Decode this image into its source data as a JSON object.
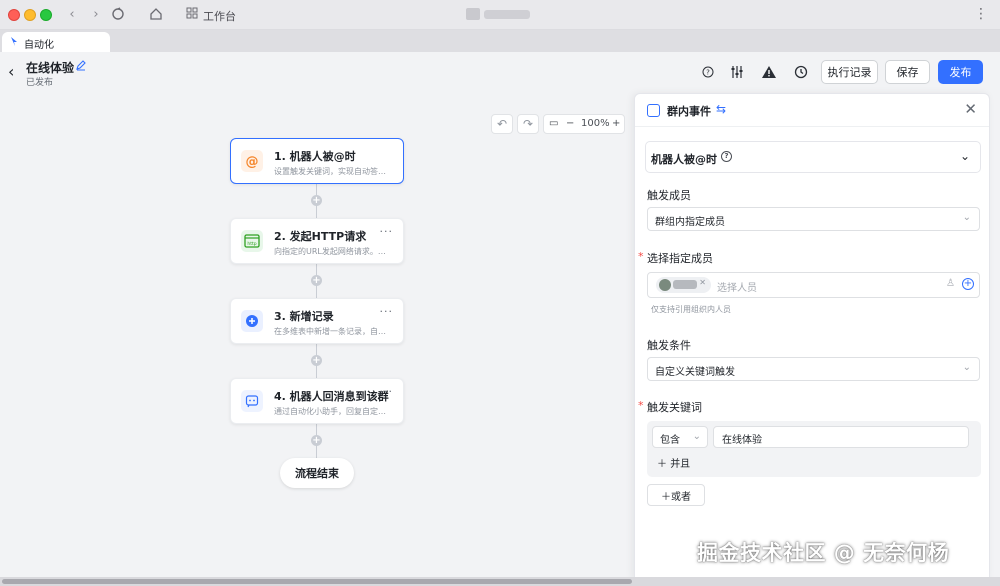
{
  "titlebar": {
    "workspace_label": "工作台"
  },
  "tab": {
    "label": "自动化"
  },
  "header": {
    "title": "在线体验",
    "status": "已发布",
    "buttons": {
      "run_history": "执行记录",
      "save": "保存",
      "publish": "发布"
    }
  },
  "toolbar": {
    "zoom": "100%"
  },
  "flow": {
    "nodes": [
      {
        "title": "1. 机器人被@时",
        "desc": "设置触发关键词，实现自动答…",
        "icon": "at-icon"
      },
      {
        "title": "2. 发起HTTP请求",
        "desc": "向指定的URL发起网络请求。…",
        "icon": "http-icon"
      },
      {
        "title": "3. 新增记录",
        "desc": "在多维表中新增一条记录，自…",
        "icon": "add-record-icon"
      },
      {
        "title": "4. 机器人回消息到该群",
        "desc": "通过自动化小助手，回复自定…",
        "icon": "bot-message-icon"
      }
    ],
    "end_label": "流程结束"
  },
  "panel": {
    "title": "群内事件",
    "trigger": "机器人被@时",
    "fields": {
      "trigger_members_label": "触发成员",
      "trigger_members_value": "群组内指定成员",
      "select_members_label": "选择指定成员",
      "select_members_placeholder": "选择人员",
      "select_members_hint": "仅支持引用组织内人员",
      "trigger_condition_label": "触发条件",
      "trigger_condition_value": "自定义关键词触发",
      "keywords_label": "触发关键词",
      "keyword_operator": "包含",
      "keyword_value": "在线体验",
      "and_label": "并且",
      "or_label": "或者"
    }
  },
  "watermark": "掘金技术社区 @ 无奈何杨",
  "colors": {
    "accent": "#3370ff",
    "required": "#f54a45"
  }
}
